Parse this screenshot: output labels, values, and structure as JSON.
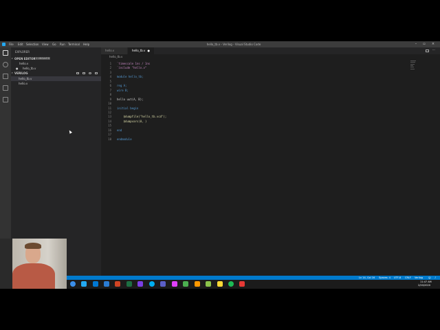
{
  "window": {
    "title": "hello_tb.v - Verilog - Visual Studio Code",
    "menu": [
      "File",
      "Edit",
      "Selection",
      "View",
      "Go",
      "Run",
      "Terminal",
      "Help"
    ]
  },
  "sidebar": {
    "header": "EXPLORER",
    "open_editors_label": "OPEN EDITORS",
    "unsaved_badge": "1 UNSAVED",
    "open_editors": [
      "hello.v",
      "hello_tb.v"
    ],
    "folder_label": "VERILOG",
    "files": [
      "hello_tb.v",
      "hello.v"
    ]
  },
  "tabs": [
    {
      "label": "hello.v",
      "active": false
    },
    {
      "label": "hello_tb.v",
      "active": true
    }
  ],
  "breadcrumb": "hello_tb.v",
  "code_lines": [
    {
      "n": "1",
      "text": "`timescale 1ns / 1ns"
    },
    {
      "n": "2",
      "text": "`include \"hello.v\""
    },
    {
      "n": "3",
      "text": ""
    },
    {
      "n": "4",
      "text": "module hello_tb;"
    },
    {
      "n": "5",
      "text": ""
    },
    {
      "n": "6",
      "text": "reg A;"
    },
    {
      "n": "7",
      "text": "wire B;"
    },
    {
      "n": "8",
      "text": ""
    },
    {
      "n": "9",
      "text": "hello uut(A, B);"
    },
    {
      "n": "10",
      "text": ""
    },
    {
      "n": "11",
      "text": "initial begin"
    },
    {
      "n": "12",
      "text": ""
    },
    {
      "n": "13",
      "text": "    $dumpfile(\"hello_tb.vcd\");"
    },
    {
      "n": "14",
      "text": "    $dumpvars(0, )"
    },
    {
      "n": "15",
      "text": ""
    },
    {
      "n": "16",
      "text": "end"
    },
    {
      "n": "17",
      "text": ""
    },
    {
      "n": "18",
      "text": "endmodule"
    }
  ],
  "statusbar": {
    "position": "Ln 14, Col 16",
    "spaces": "Spaces: 4",
    "encoding": "UTF-8",
    "eol": "CRLF",
    "language": "Verilog"
  },
  "taskbar": {
    "time": "11:47 AM",
    "date": "2/20/2020"
  },
  "colors": {
    "accent": "#007acc",
    "editor_bg": "#1e1e1e",
    "sidebar_bg": "#252526",
    "activity_bg": "#333333"
  }
}
